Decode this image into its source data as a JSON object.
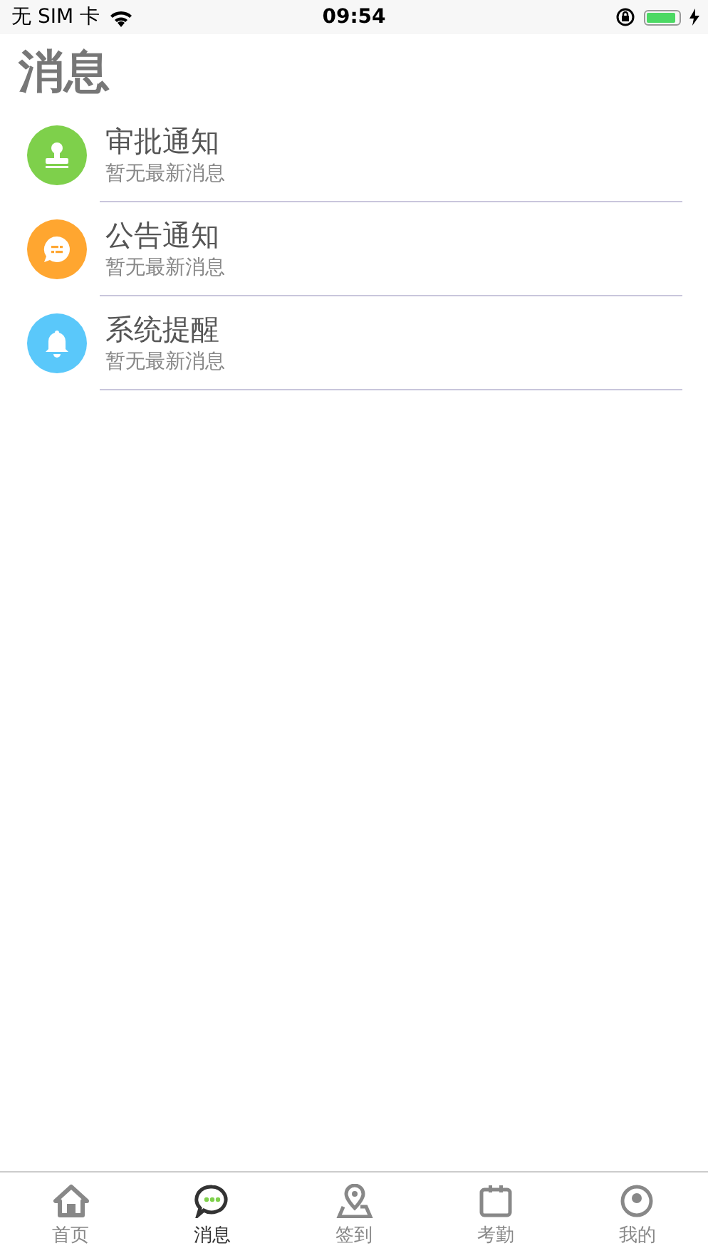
{
  "status_bar": {
    "carrier": "无 SIM 卡",
    "time": "09:54"
  },
  "title": "消息",
  "messages": [
    {
      "kind": "approval",
      "title": "审批通知",
      "subtitle": "暂无最新消息",
      "color": "#7ed04b"
    },
    {
      "kind": "announcement",
      "title": "公告通知",
      "subtitle": "暂无最新消息",
      "color": "#ffa630"
    },
    {
      "kind": "reminder",
      "title": "系统提醒",
      "subtitle": "暂无最新消息",
      "color": "#5ac8fa"
    }
  ],
  "tab_bar": [
    {
      "kind": "home",
      "label": "首页",
      "selected": false
    },
    {
      "kind": "messages",
      "label": "消息",
      "selected": true
    },
    {
      "kind": "checkin",
      "label": "签到",
      "selected": false
    },
    {
      "kind": "attendance",
      "label": "考勤",
      "selected": false
    },
    {
      "kind": "profile",
      "label": "我的",
      "selected": false
    }
  ]
}
